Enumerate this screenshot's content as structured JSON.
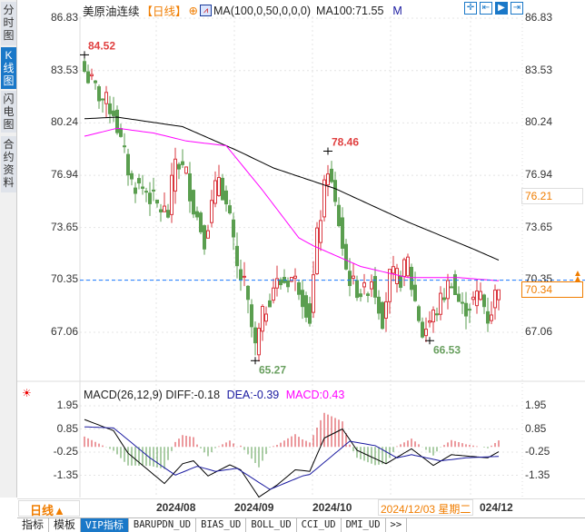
{
  "sidebar": {
    "tabs": [
      {
        "label": "分时图"
      },
      {
        "label": "K线图",
        "selected": true
      },
      {
        "label": "闪电图"
      },
      {
        "label": "合约资料"
      }
    ]
  },
  "header": {
    "symbol": "美原油连续",
    "period": "【日线】",
    "indicator": "MA(100,0,50,0,0,0)",
    "ma100": "MA100:71.55",
    "mode": "M"
  },
  "toolbar_icons": [
    "crosshair-icon",
    "range-select-icon",
    "play-forward-icon",
    "move-right-icon"
  ],
  "price_axis": {
    "labels": [
      "86.83",
      "83.53",
      "80.24",
      "76.94",
      "73.65",
      "70.35",
      "67.06"
    ],
    "values": [
      86.83,
      83.53,
      80.24,
      76.94,
      73.65,
      70.35,
      67.06
    ],
    "ma_badge": "76.21",
    "current_price": "70.34",
    "current_value": 70.34
  },
  "annotations": [
    {
      "label": "84.52",
      "index": 0,
      "value": 84.52,
      "kind": "high"
    },
    {
      "label": "65.27",
      "index": 47,
      "value": 65.27,
      "kind": "low"
    },
    {
      "label": "78.46",
      "index": 67,
      "value": 78.46,
      "kind": "high"
    },
    {
      "label": "66.53",
      "index": 95,
      "value": 66.53,
      "kind": "low"
    }
  ],
  "chart_data": {
    "type": "candlestick",
    "candle_count": 115,
    "close_keypoints": [
      [
        0,
        83.5
      ],
      [
        4,
        82
      ],
      [
        8,
        81
      ],
      [
        10,
        79
      ],
      [
        13,
        76.5
      ],
      [
        17,
        76
      ],
      [
        20,
        75
      ],
      [
        23,
        74.5
      ],
      [
        25,
        78
      ],
      [
        28,
        77
      ],
      [
        30,
        75
      ],
      [
        33,
        73
      ],
      [
        37,
        77
      ],
      [
        40,
        74
      ],
      [
        42,
        71
      ],
      [
        44,
        70
      ],
      [
        47,
        66
      ],
      [
        49,
        68
      ],
      [
        52,
        70
      ],
      [
        57,
        70.5
      ],
      [
        59,
        70
      ],
      [
        62,
        68
      ],
      [
        64,
        73
      ],
      [
        67,
        77.5
      ],
      [
        69,
        75
      ],
      [
        70,
        74
      ],
      [
        72,
        71
      ],
      [
        74,
        70
      ],
      [
        77,
        69.5
      ],
      [
        79,
        70.5
      ],
      [
        82,
        68
      ],
      [
        84,
        70.5
      ],
      [
        87,
        70.5
      ],
      [
        89,
        71.5
      ],
      [
        90,
        70
      ],
      [
        93,
        67
      ],
      [
        97,
        68.5
      ],
      [
        99,
        69.5
      ],
      [
        101,
        70.5
      ],
      [
        102,
        69.5
      ],
      [
        104,
        68.5
      ],
      [
        107,
        69
      ],
      [
        109,
        69.5
      ],
      [
        111,
        68
      ],
      [
        112,
        68.5
      ],
      [
        114,
        70.3
      ]
    ],
    "ma100_keypoints": [
      [
        0,
        80.5
      ],
      [
        9,
        80.6
      ],
      [
        27,
        80.0
      ],
      [
        42,
        78.5
      ],
      [
        52,
        77.4
      ],
      [
        69,
        76.1
      ],
      [
        89,
        74
      ],
      [
        107,
        72.3
      ],
      [
        114,
        71.6
      ]
    ],
    "ma50_keypoints": [
      [
        0,
        79.4
      ],
      [
        9,
        79.9
      ],
      [
        19,
        79.6
      ],
      [
        28,
        79.1
      ],
      [
        39,
        78.8
      ],
      [
        49,
        76
      ],
      [
        59,
        73
      ],
      [
        63,
        72.5
      ],
      [
        76,
        71.2
      ],
      [
        89,
        70.5
      ],
      [
        103,
        70.5
      ],
      [
        114,
        70.3
      ]
    ],
    "ylim": [
      67.06,
      86.83
    ],
    "x_labels": [
      "2024/08",
      "2024/09",
      "2024/10"
    ]
  },
  "macd": {
    "title": "MACD(26,12,9)",
    "diff": "DIFF:-0.18",
    "dea": "DEA:-0.39",
    "macd": "MACD:0.43",
    "labels": [
      "1.95",
      "0.85",
      "-0.25",
      "-1.35"
    ],
    "values": [
      1.95,
      0.85,
      -0.25,
      -1.35
    ],
    "diff_keypoints": [
      [
        0,
        1.3
      ],
      [
        8,
        0.77
      ],
      [
        12,
        -0.3
      ],
      [
        22,
        -1.74
      ],
      [
        27,
        -0.8
      ],
      [
        30,
        -0.66
      ],
      [
        34,
        -1.38
      ],
      [
        40,
        -0.85
      ],
      [
        43,
        -1.09
      ],
      [
        48,
        -2.38
      ],
      [
        53,
        -1.81
      ],
      [
        58,
        -1.09
      ],
      [
        62,
        -1.16
      ],
      [
        66,
        0.42
      ],
      [
        71,
        0.85
      ],
      [
        75,
        -0.16
      ],
      [
        83,
        -0.8
      ],
      [
        90,
        -0.09
      ],
      [
        96,
        -0.88
      ],
      [
        101,
        -0.37
      ],
      [
        111,
        -0.52
      ],
      [
        114,
        -0.23
      ]
    ],
    "dea_keypoints": [
      [
        0,
        0.95
      ],
      [
        8,
        0.9
      ],
      [
        18,
        -0.52
      ],
      [
        25,
        -1.34
      ],
      [
        31,
        -0.92
      ],
      [
        36,
        -1.16
      ],
      [
        42,
        -1.02
      ],
      [
        51,
        -2.02
      ],
      [
        60,
        -1.38
      ],
      [
        62,
        -1.31
      ],
      [
        73,
        0.27
      ],
      [
        80,
        0.06
      ],
      [
        86,
        -0.52
      ],
      [
        90,
        -0.37
      ],
      [
        98,
        -0.66
      ],
      [
        105,
        -0.52
      ],
      [
        114,
        -0.45
      ]
    ]
  },
  "xaxis": {
    "period": "日线▲",
    "labels": [
      "2024/08",
      "2024/09",
      "2024/10"
    ],
    "tooltip": "2024/12/03 星期二",
    "last": "024/12"
  },
  "tabs": [
    "指标",
    "模板",
    "VIP指标",
    "BARUPDN_UD",
    "BIAS_UD",
    "BOLL_UD",
    "CCI_UD",
    "DMI_UD",
    ">>"
  ],
  "colors": {
    "up": "#d9363e",
    "down": "#5a9e4f",
    "ma100": "#000000",
    "ma50": "#ff00ff",
    "accent": "#1a78c8",
    "orange": "#f07d00"
  }
}
